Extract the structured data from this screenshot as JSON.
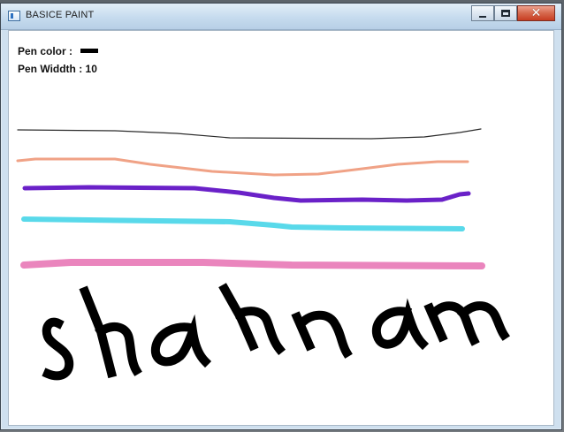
{
  "window": {
    "title": "BASICE PAINT",
    "controls": [
      "minimize",
      "maximize",
      "close"
    ]
  },
  "status": {
    "pen_color_label": "Pen color :",
    "pen_color": "#000000",
    "pen_width_label": "Pen Widdth : 10"
  },
  "icons": {
    "app": "paint-app-icon",
    "minimize": "minimize-icon",
    "maximize": "maximize-icon",
    "close": "close-icon"
  },
  "strokes": {
    "line_colors": [
      "#2b2b2b",
      "#f0a286",
      "#6a21c8",
      "#59d9ea",
      "#ea85bd"
    ],
    "text_color": "#000000"
  }
}
